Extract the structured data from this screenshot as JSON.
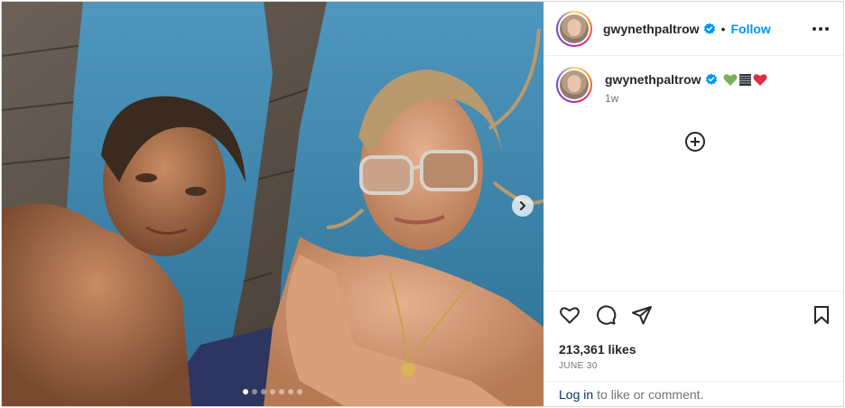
{
  "post": {
    "username": "gwynethpaltrow",
    "follow_label": "Follow",
    "separator": "•",
    "caption_emojis": [
      "green-heart",
      "black-heart-flag",
      "red-heart"
    ],
    "time_ago": "1w",
    "likes": "213,361 likes",
    "date": "JUNE 30",
    "carousel": {
      "slide_count": 7,
      "active_index": 0
    }
  },
  "login_prompt": {
    "link_label": "Log in",
    "rest_text": "to like or comment."
  },
  "icons": {
    "verified": "verified-badge-icon",
    "more": "more-options-icon",
    "add": "add-comment-icon",
    "like": "heart-icon",
    "comment": "comment-icon",
    "share": "share-icon",
    "save": "bookmark-icon",
    "next": "chevron-right-icon"
  },
  "colors": {
    "follow": "#0095f6",
    "verified": "#0095f6",
    "login_link": "#00376b",
    "muted": "#737373"
  }
}
